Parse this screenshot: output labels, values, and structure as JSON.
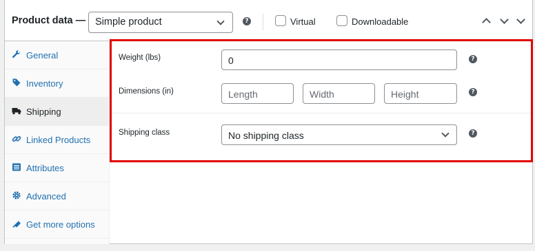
{
  "header": {
    "title": "Product data —",
    "product_type": "Simple product",
    "virtual_label": "Virtual",
    "downloadable_label": "Downloadable"
  },
  "sidebar": {
    "items": [
      {
        "label": "General",
        "icon": "wrench-icon"
      },
      {
        "label": "Inventory",
        "icon": "tag-icon"
      },
      {
        "label": "Shipping",
        "icon": "truck-icon",
        "active": true
      },
      {
        "label": "Linked Products",
        "icon": "link-icon"
      },
      {
        "label": "Attributes",
        "icon": "list-icon"
      },
      {
        "label": "Advanced",
        "icon": "gear-icon"
      },
      {
        "label": "Get more options",
        "icon": "plugin-icon"
      }
    ]
  },
  "shipping": {
    "weight_label": "Weight (lbs)",
    "weight_placeholder": "0",
    "dimensions_label": "Dimensions (in)",
    "length_placeholder": "Length",
    "width_placeholder": "Width",
    "height_placeholder": "Height",
    "class_label": "Shipping class",
    "class_value": "No shipping class"
  },
  "colors": {
    "link": "#2271b1",
    "highlight_border": "#e00000",
    "active_tab": "#eeeeee"
  }
}
